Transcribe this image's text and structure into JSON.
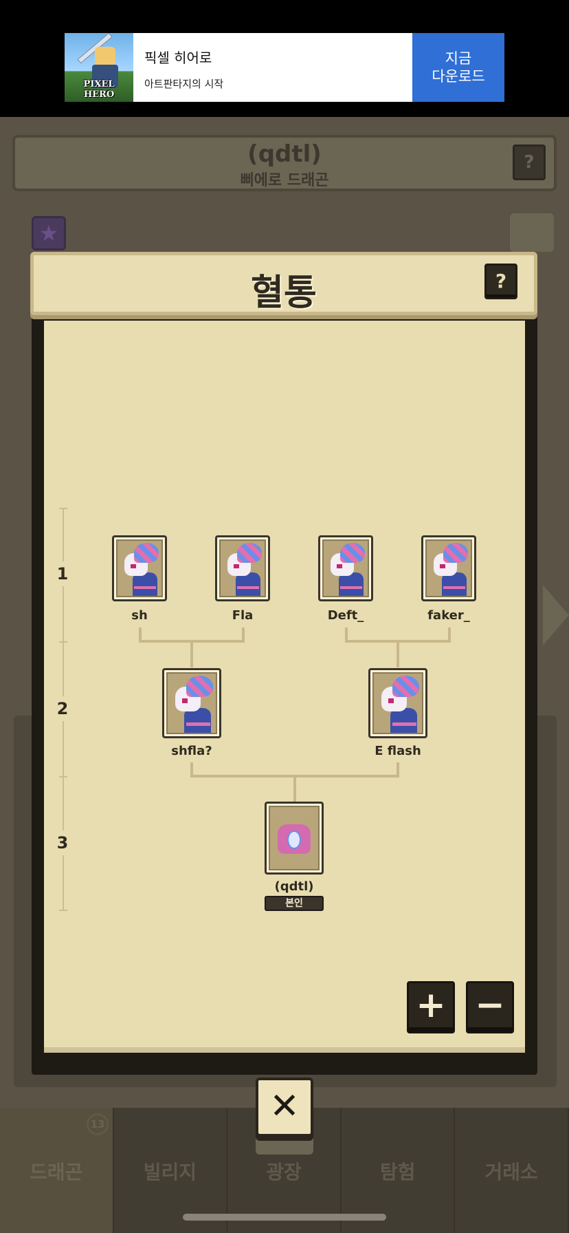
{
  "ad": {
    "logo_text": "PIXEL HERO",
    "title": "픽셀 히어로",
    "subtitle": "아트판타지의 시작",
    "cta": "지금\n다운로드"
  },
  "background": {
    "dragon_name": "(qdtl)",
    "dragon_breed": "삐에로 드래곤",
    "help_glyph": "?",
    "tabs": [
      {
        "label": "드래곤",
        "badge": "13"
      },
      {
        "label": "빌리지"
      },
      {
        "label": "광장"
      },
      {
        "label": "탐험"
      },
      {
        "label": "거래소"
      }
    ]
  },
  "modal": {
    "title": "혈통",
    "help_glyph": "?",
    "generations": [
      "1",
      "2",
      "3"
    ],
    "gen1": [
      "sh",
      "Fla",
      "Deft_",
      "faker_"
    ],
    "gen2": [
      "shfla?",
      "E flash"
    ],
    "gen3": {
      "name": "(qdtl)",
      "badge": "본인"
    },
    "zoom_in": "+",
    "zoom_out": "−",
    "close": "✕"
  },
  "colors": {
    "paper": "#e8ddb0",
    "frame": "#1e1a14",
    "ad_cta": "#2f6fd6"
  }
}
